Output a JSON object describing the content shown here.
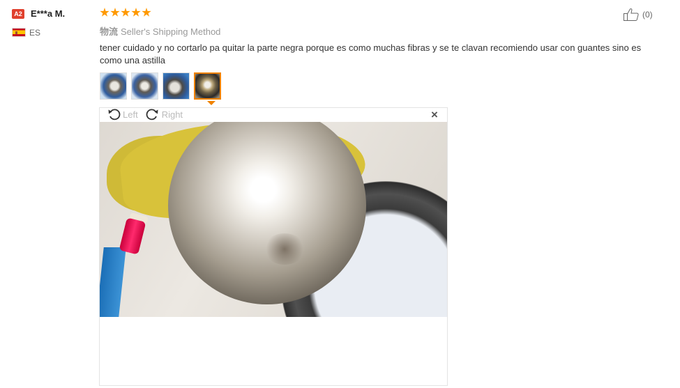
{
  "reviewer": {
    "level_badge": "A2",
    "name": "E***a M.",
    "country": "ES",
    "flag_icon": "spain-flag-icon"
  },
  "review": {
    "rating": 5,
    "max_rating": 5,
    "shipping_prefix": "物流",
    "shipping_method": "Seller's Shipping Method",
    "text": "tener cuidado y no cortarlo pa quitar la parte negra porque es como muchas fibras y se te clavan recomiendo usar con guantes sino es como una astilla",
    "helpful_count": "(0)"
  },
  "thumbnails": [
    {
      "icon": "photo-thumbnail-1",
      "active": false
    },
    {
      "icon": "photo-thumbnail-2",
      "active": false
    },
    {
      "icon": "photo-thumbnail-3",
      "active": false
    },
    {
      "icon": "photo-thumbnail-4",
      "active": true
    }
  ],
  "viewer": {
    "rotate_left_label": "Left",
    "rotate_right_label": "Right",
    "close_symbol": "×"
  },
  "colors": {
    "star": "#ff9900",
    "badge": "#e0402d",
    "active_thumb_border": "#f08200",
    "muted_text": "#999999"
  }
}
